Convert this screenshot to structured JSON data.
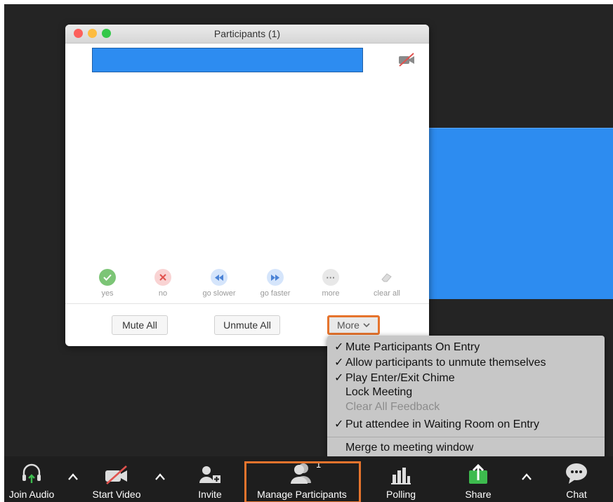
{
  "window": {
    "title": "Participants (1)",
    "participant_name": "",
    "feedback": [
      {
        "label": "yes",
        "icon": "check-icon",
        "color": "#7cc576"
      },
      {
        "label": "no",
        "icon": "x-icon",
        "color": "#f17c7c"
      },
      {
        "label": "go slower",
        "icon": "rewind-icon",
        "color": "#79a7e8"
      },
      {
        "label": "go faster",
        "icon": "fast-forward-icon",
        "color": "#79a7e8"
      },
      {
        "label": "more",
        "icon": "ellipsis-icon",
        "color": "#b5b5b5"
      },
      {
        "label": "clear all",
        "icon": "eraser-icon",
        "color": "#b5b5b5"
      }
    ],
    "buttons": {
      "mute_all": "Mute All",
      "unmute_all": "Unmute All",
      "more": "More"
    }
  },
  "more_menu": {
    "items": [
      {
        "label": "Mute Participants On Entry",
        "checked": "✓"
      },
      {
        "label": "Allow participants to unmute themselves",
        "checked": "✓"
      },
      {
        "label": "Play Enter/Exit Chime",
        "checked": "✓"
      },
      {
        "label": "Lock Meeting",
        "checked": ""
      },
      {
        "label": "Clear All Feedback",
        "checked": "",
        "disabled": true
      },
      {
        "label": "Put attendee in Waiting Room on Entry",
        "checked": "✓"
      },
      {
        "label": "Merge to meeting window",
        "checked": ""
      }
    ]
  },
  "toolbar": {
    "join_audio": "Join Audio",
    "start_video": "Start Video",
    "invite": "Invite",
    "manage_participants": "Manage Participants",
    "participant_count": "1",
    "polling": "Polling",
    "share": "Share",
    "chat": "Chat"
  },
  "colors": {
    "highlight": "#e6742d",
    "participant_block": "#2d8cf0",
    "share_green": "#3dbb4e"
  }
}
